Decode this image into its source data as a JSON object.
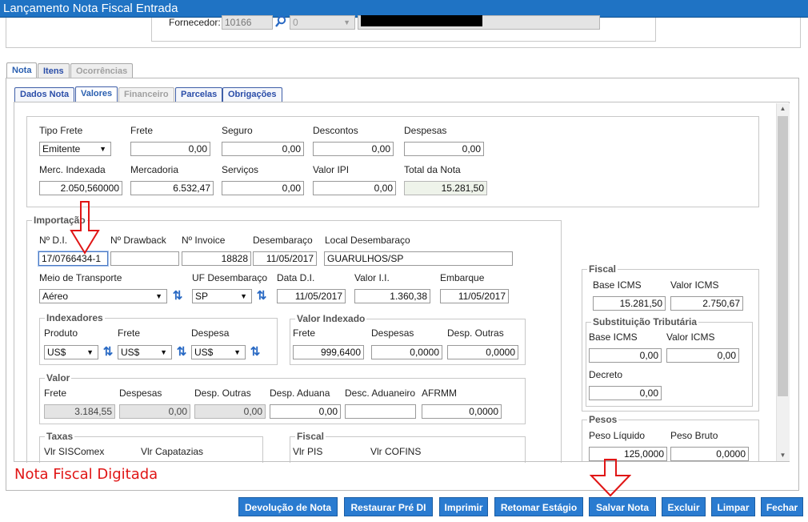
{
  "window": {
    "title": "Lançamento Nota Fiscal Entrada"
  },
  "supplier": {
    "label": "Fornecedor:",
    "code": "10166",
    "select_value": "0",
    "name": ""
  },
  "main_tabs": [
    "Nota",
    "Itens",
    "Ocorrências"
  ],
  "sub_tabs": [
    "Dados Nota",
    "Valores",
    "Financeiro",
    "Parcelas",
    "Obrigações"
  ],
  "totals": {
    "tipo_frete_label": "Tipo Frete",
    "tipo_frete_value": "Emitente",
    "frete_label": "Frete",
    "frete_value": "0,00",
    "seguro_label": "Seguro",
    "seguro_value": "0,00",
    "descontos_label": "Descontos",
    "descontos_value": "0,00",
    "despesas_label": "Despesas",
    "despesas_value": "0,00",
    "merc_indexada_label": "Merc. Indexada",
    "merc_indexada_value": "2.050,560000",
    "mercadoria_label": "Mercadoria",
    "mercadoria_value": "6.532,47",
    "servicos_label": "Serviços",
    "servicos_value": "0,00",
    "valor_ipi_label": "Valor IPI",
    "valor_ipi_value": "0,00",
    "total_nota_label": "Total da Nota",
    "total_nota_value": "15.281,50"
  },
  "importacao": {
    "legend": "Importação",
    "di_label": "Nº D.I.",
    "di_value": "17/0766434-1",
    "drawback_label": "Nº Drawback",
    "drawback_value": "",
    "invoice_label": "Nº Invoice",
    "invoice_value": "18828",
    "desembaraco_label": "Desembaraço",
    "desembaraco_value": "11/05/2017",
    "local_label": "Local Desembaraço",
    "local_value": "GUARULHOS/SP",
    "meio_label": "Meio de Transporte",
    "meio_value": "Aéreo",
    "uf_label": "UF Desembaraço",
    "uf_value": "SP",
    "data_di_label": "Data D.I.",
    "data_di_value": "11/05/2017",
    "valor_ii_label": "Valor I.I.",
    "valor_ii_value": "1.360,38",
    "embarque_label": "Embarque",
    "embarque_value": "11/05/2017"
  },
  "indexadores": {
    "legend": "Indexadores",
    "produto_label": "Produto",
    "produto_value": "US$",
    "frete_label": "Frete",
    "frete_value": "US$",
    "despesa_label": "Despesa",
    "despesa_value": "US$"
  },
  "valor_indexado": {
    "legend": "Valor Indexado",
    "frete_label": "Frete",
    "frete_value": "999,6400",
    "despesas_label": "Despesas",
    "despesas_value": "0,0000",
    "desp_outras_label": "Desp. Outras",
    "desp_outras_value": "0,0000"
  },
  "valor": {
    "legend": "Valor",
    "frete_label": "Frete",
    "frete_value": "3.184,55",
    "despesas_label": "Despesas",
    "despesas_value": "0,00",
    "desp_outras_label": "Desp. Outras",
    "desp_outras_value": "0,00",
    "desp_aduana_label": "Desp. Aduana",
    "desp_aduana_value": "0,00",
    "desc_aduaneiro_label": "Desc. Aduaneiro",
    "desc_aduaneiro_value": "",
    "afrmm_label": "AFRMM",
    "afrmm_value": "0,0000"
  },
  "taxas": {
    "legend": "Taxas",
    "siscomex_label": "Vlr SISComex",
    "capatazias_label": "Vlr Capatazias"
  },
  "fiscal_import": {
    "legend": "Fiscal",
    "pis_label": "Vlr PIS",
    "cofins_label": "Vlr COFINS"
  },
  "fiscal": {
    "legend": "Fiscal",
    "base_icms_label": "Base ICMS",
    "base_icms_value": "15.281,50",
    "valor_icms_label": "Valor ICMS",
    "valor_icms_value": "2.750,67"
  },
  "substituicao": {
    "legend": "Substituição Tributária",
    "base_icms_label": "Base ICMS",
    "base_icms_value": "0,00",
    "valor_icms_label": "Valor ICMS",
    "valor_icms_value": "0,00",
    "decreto_label": "Decreto",
    "decreto_value": "0,00"
  },
  "pesos": {
    "legend": "Pesos",
    "liquido_label": "Peso Líquido",
    "liquido_value": "125,0000",
    "bruto_label": "Peso Bruto",
    "bruto_value": "0,0000"
  },
  "annotation": {
    "text": "Nota Fiscal Digitada"
  },
  "buttons": [
    "Devolução de Nota",
    "Restaurar Pré DI",
    "Imprimir",
    "Retomar Estágio",
    "Salvar Nota",
    "Excluir",
    "Limpar",
    "Fechar"
  ],
  "colors": {
    "title_bar": "#1f73c4",
    "button": "#2a7bd0",
    "annotation": "#e01515"
  }
}
